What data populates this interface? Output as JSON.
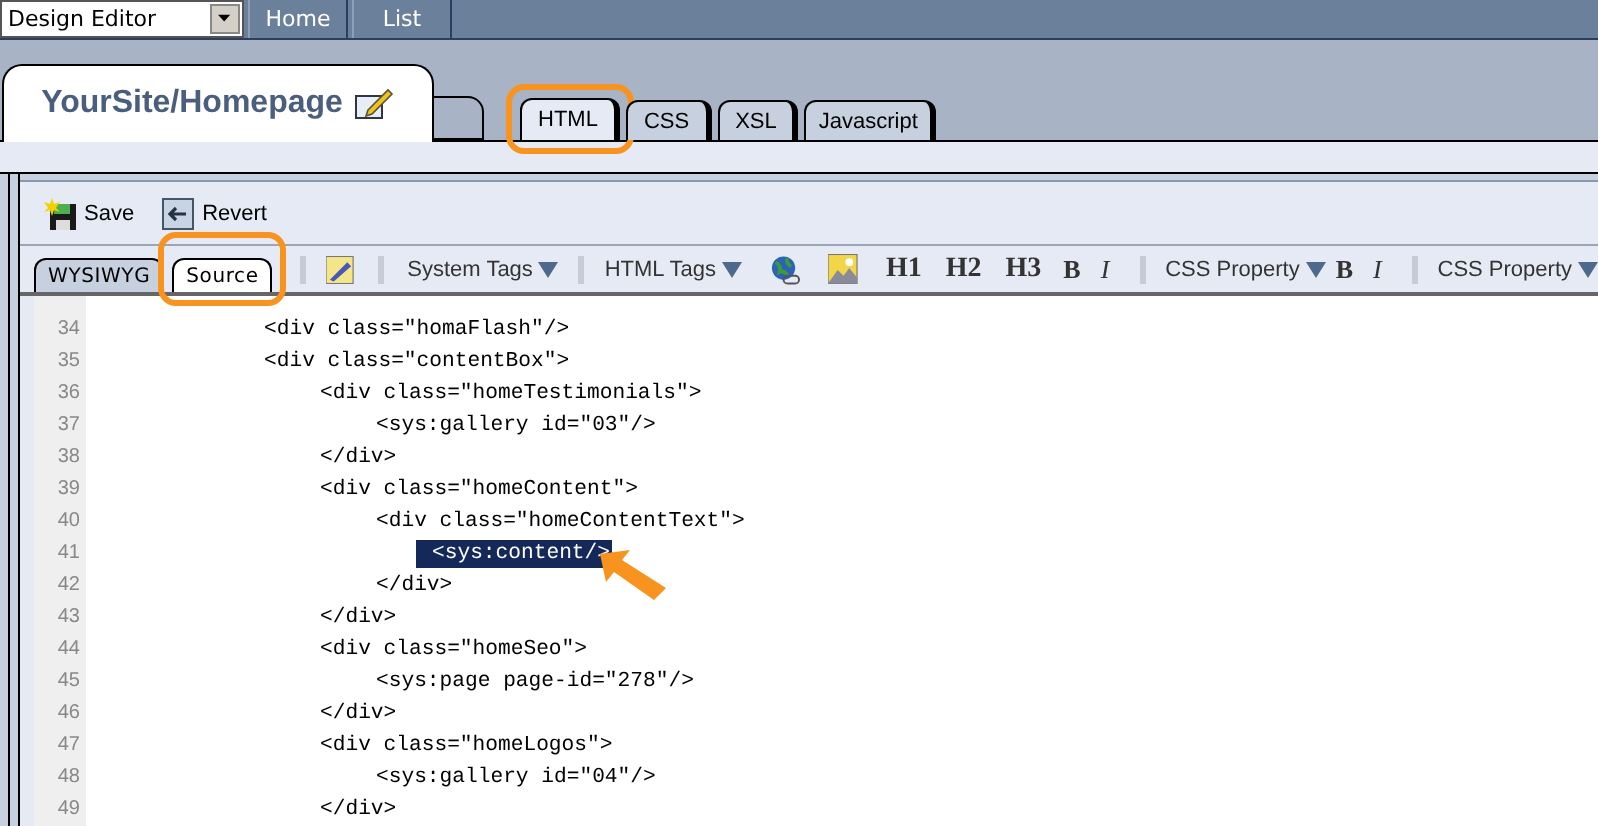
{
  "top_bar": {
    "view_select": {
      "value": "Design Editor"
    },
    "nav_tabs": [
      {
        "label": "Home"
      },
      {
        "label": "List"
      }
    ]
  },
  "page_tab": {
    "title": "YourSite/Homepage"
  },
  "file_tabs": [
    {
      "label": "HTML",
      "selected": true,
      "highlighted": true
    },
    {
      "label": "CSS",
      "selected": false,
      "highlighted": false
    },
    {
      "label": "XSL",
      "selected": false,
      "highlighted": false
    },
    {
      "label": "Javascript",
      "selected": false,
      "highlighted": false
    }
  ],
  "actions": [
    {
      "label": "Save"
    },
    {
      "label": "Revert"
    }
  ],
  "editor_tabs": [
    {
      "label": "WYSIWYG",
      "selected": false,
      "highlighted": false
    },
    {
      "label": "Source",
      "selected": true,
      "highlighted": true
    }
  ],
  "toolbar": {
    "tag_menus": [
      {
        "label": "System Tags"
      },
      {
        "label": "HTML Tags"
      }
    ],
    "headings": [
      "H1",
      "H2",
      "H3"
    ],
    "format": [
      "B",
      "I"
    ],
    "css_menus": [
      {
        "label": "CSS Property"
      },
      {
        "label": "CSS Property"
      }
    ],
    "format_2": [
      "B",
      "I"
    ]
  },
  "code": {
    "lines": [
      {
        "number": "34",
        "text": "<div class=\"homaFlash\"/>",
        "selected": false,
        "pointed": false
      },
      {
        "number": "35",
        "text": "<div class=\"contentBox\">",
        "selected": false,
        "pointed": false,
        "children": [
          {
            "number": "36",
            "text": "<div class=\"homeTestimonials\">",
            "selected": false,
            "pointed": false,
            "children": [
              {
                "number": "37",
                "text": "<sys:gallery id=\"03\"/>",
                "selected": false,
                "pointed": false
              }
            ]
          },
          {
            "number": "38",
            "text": "</div>",
            "selected": false,
            "pointed": false
          },
          {
            "number": "39",
            "text": "<div class=\"homeContent\">",
            "selected": false,
            "pointed": false,
            "children": [
              {
                "number": "40",
                "text": "<div class=\"homeContentText\">",
                "selected": false,
                "pointed": false,
                "children": [
                  {
                    "number": "41",
                    "text": "<sys:content/>",
                    "selected": true,
                    "pointed": true
                  }
                ]
              },
              {
                "number": "42",
                "text": "</div>",
                "selected": false,
                "pointed": false
              }
            ]
          },
          {
            "number": "43",
            "text": "</div>",
            "selected": false,
            "pointed": false
          },
          {
            "number": "44",
            "text": "<div class=\"homeSeo\">",
            "selected": false,
            "pointed": false,
            "children": [
              {
                "number": "45",
                "text": "<sys:page page-id=\"278\"/>",
                "selected": false,
                "pointed": false
              }
            ]
          },
          {
            "number": "46",
            "text": "</div>",
            "selected": false,
            "pointed": false
          },
          {
            "number": "47",
            "text": "<div class=\"homeLogos\">",
            "selected": false,
            "pointed": false,
            "children": [
              {
                "number": "48",
                "text": "<sys:gallery id=\"04\"/>",
                "selected": false,
                "pointed": false
              }
            ]
          },
          {
            "number": "49",
            "text": "</div>",
            "selected": false,
            "pointed": false
          }
        ]
      }
    ]
  }
}
